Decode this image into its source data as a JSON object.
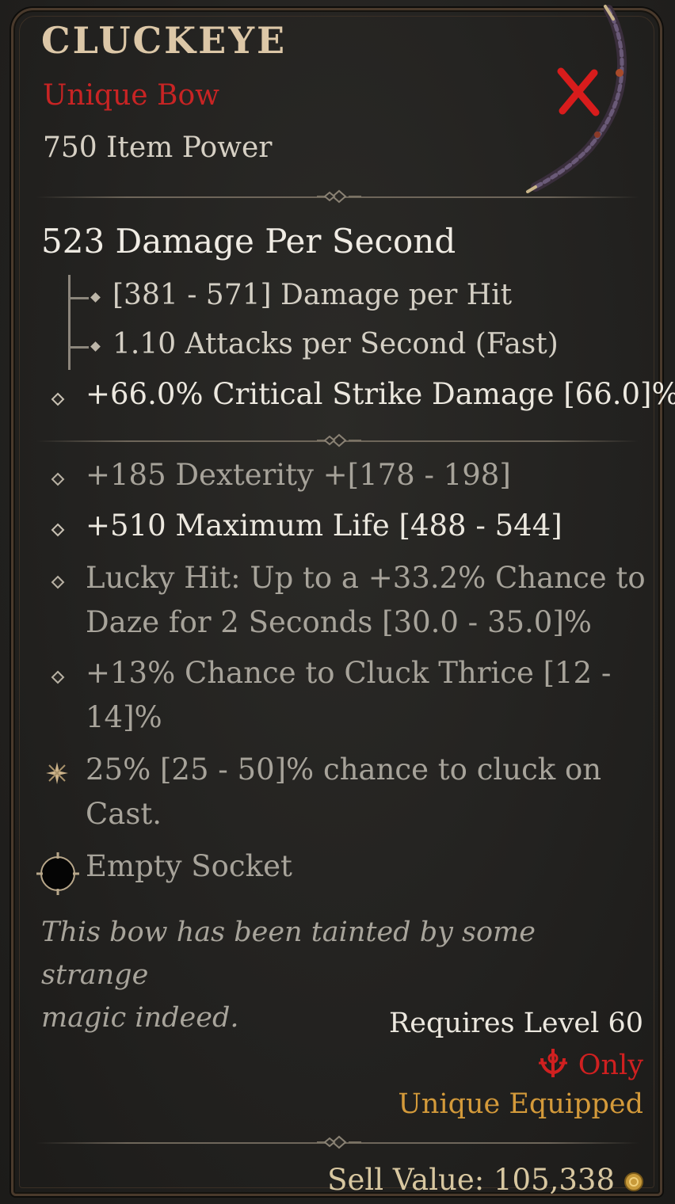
{
  "item": {
    "name": "CLUCKEYE",
    "type": "Unique Bow",
    "item_power": "750 Item Power"
  },
  "weapon": {
    "dps": "523 Damage Per Second",
    "damage_per_hit": "[381 - 571] Damage per Hit",
    "attacks_per_second": "1.10 Attacks per Second (Fast)",
    "implicit": "+66.0% Critical Strike Damage [66.0]%"
  },
  "affixes": [
    {
      "text": "+185 Dexterity +[178 - 198]",
      "style": "dim"
    },
    {
      "text": "+510 Maximum Life [488 - 544]",
      "style": "bright"
    },
    {
      "line1": "Lucky Hit: Up to a +33.2% Chance to",
      "line2": "Daze for 2 Seconds [30.0 - 35.0]%",
      "style": "dim"
    },
    {
      "line1": "+13% Chance to Cluck Thrice [12 -",
      "line2": "14]%",
      "style": "dim"
    }
  ],
  "unique_power": {
    "line1": "25% [25 - 50]% chance to cluck on",
    "line2": "Cast.",
    "icon": "unique-star-icon"
  },
  "socket": {
    "label": "Empty Socket",
    "icon": "empty-socket-icon"
  },
  "flavor": {
    "line1": "This bow has been tainted by some strange",
    "line2": "magic indeed."
  },
  "requirements": {
    "level": "Requires Level 60",
    "class_only": "Only",
    "class_icon": "rogue-class-icon",
    "unique_equipped": "Unique Equipped"
  },
  "sell": {
    "label": "Sell Value: 105,338",
    "icon": "gold-coin-icon"
  },
  "colors": {
    "unique_red": "#c82424",
    "gold_text": "#d49a3a",
    "title": "#dcc7a7",
    "bright_text": "#ece8df",
    "dim_text": "#a7a39a"
  },
  "icons": {
    "close": "red-x-icon",
    "item": "bow-icon"
  }
}
